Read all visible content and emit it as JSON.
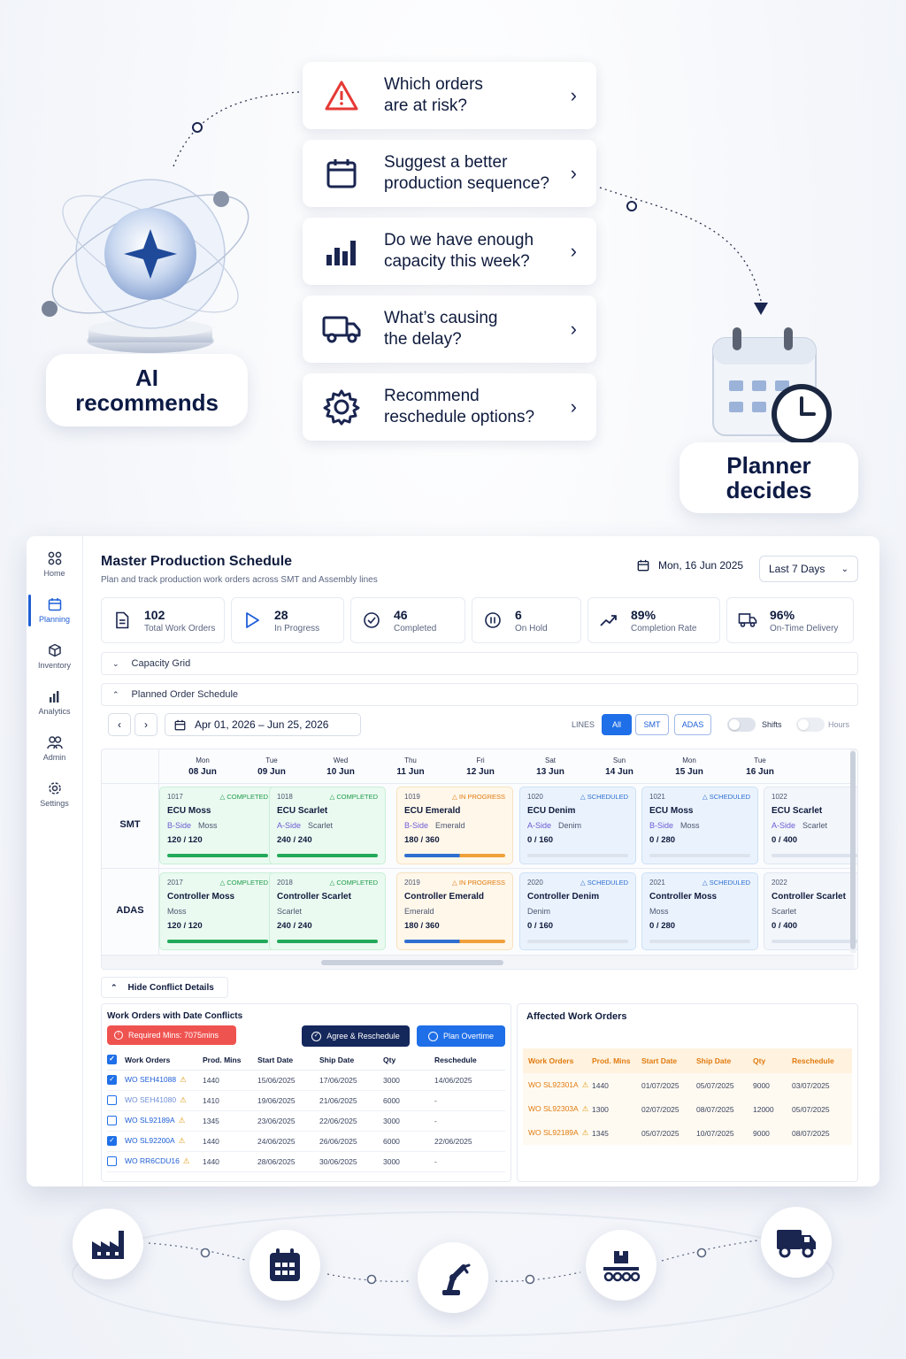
{
  "hero": {
    "ai_label": "AI\nrecommends",
    "planner_label": "Planner\ndecides",
    "questions": [
      {
        "icon": "warning-icon",
        "text": "Which orders\nare at risk?"
      },
      {
        "icon": "calendar-icon",
        "text": "Suggest a better\nproduction sequence?"
      },
      {
        "icon": "bar-chart-icon",
        "text": "Do we have enough\ncapacity this week?"
      },
      {
        "icon": "truck-icon",
        "text": "What’s causing\nthe delay?"
      },
      {
        "icon": "gear-icon",
        "text": "Recommend\nreschedule options?"
      }
    ]
  },
  "sidebar": {
    "items": [
      {
        "label": "Home",
        "icon": "grid-icon"
      },
      {
        "label": "Planning",
        "icon": "calendar-icon",
        "active": true
      },
      {
        "label": "Inventory",
        "icon": "box-icon"
      },
      {
        "label": "Analytics",
        "icon": "bar-chart-icon"
      },
      {
        "label": "Admin",
        "icon": "users-icon"
      },
      {
        "label": "Settings",
        "icon": "gear-icon"
      }
    ]
  },
  "header": {
    "title": "Master Production Schedule",
    "subtitle": "Plan and track production work orders across SMT and Assembly lines",
    "date": "Mon, 16 Jun 2025",
    "range": "Last 7 Days"
  },
  "kpis": [
    {
      "value": "102",
      "label": "Total Work Orders",
      "icon": "document-icon"
    },
    {
      "value": "28",
      "label": "In Progress",
      "icon": "play-icon"
    },
    {
      "value": "46",
      "label": "Completed",
      "icon": "check-circle-icon"
    },
    {
      "value": "6",
      "label": "On Hold",
      "icon": "pause-icon"
    },
    {
      "value": "89%",
      "label": "Completion Rate",
      "icon": "trend-up-icon"
    },
    {
      "value": "96%",
      "label": "On-Time Delivery",
      "icon": "truck-icon"
    }
  ],
  "sections": {
    "capacity_grid": "Capacity Grid",
    "planned_schedule": "Planned Order Schedule",
    "hide_conflicts": "Hide Conflict Details"
  },
  "toolbar": {
    "date_range": "Apr 01, 2026 – Jun 25, 2026",
    "lines_label": "LINES",
    "chips": [
      "All",
      "SMT",
      "ADAS"
    ],
    "shifts_label": "Shifts",
    "hours_label": "Hours"
  },
  "days": [
    {
      "dow": "Mon",
      "date": "08 Jun"
    },
    {
      "dow": "Tue",
      "date": "09 Jun"
    },
    {
      "dow": "Wed",
      "date": "10 Jun"
    },
    {
      "dow": "Thu",
      "date": "11 Jun"
    },
    {
      "dow": "Fri",
      "date": "12 Jun"
    },
    {
      "dow": "Sat",
      "date": "13 Jun"
    },
    {
      "dow": "Sun",
      "date": "14 Jun"
    },
    {
      "dow": "Mon",
      "date": "15 Jun"
    },
    {
      "dow": "Tue",
      "date": "16 Jun"
    }
  ],
  "rows": [
    {
      "line": "SMT",
      "orders": [
        {
          "id": "1017",
          "status": "COMPLETED",
          "kind": "completed",
          "name": "ECU Moss",
          "side": "B-Side",
          "variant": "Moss",
          "qty": "120 / 120",
          "progress": 1.0
        },
        {
          "id": "1018",
          "status": "COMPLETED",
          "kind": "completed",
          "name": "ECU Scarlet",
          "side": "A-Side",
          "variant": "Scarlet",
          "qty": "240 / 240",
          "progress": 1.0
        },
        {
          "id": "1019",
          "status": "IN PROGRESS",
          "kind": "inprogress",
          "name": "ECU Emerald",
          "side": "B-Side",
          "variant": "Emerald",
          "qty": "180 / 360",
          "progress": 1.0
        },
        {
          "id": "1020",
          "status": "SCHEDULED",
          "kind": "scheduled",
          "name": "ECU Denim",
          "side": "A-Side",
          "variant": "Denim",
          "qty": "0 / 160",
          "progress": 0.0
        },
        {
          "id": "1021",
          "status": "SCHEDULED",
          "kind": "scheduled",
          "name": "ECU Moss",
          "side": "B-Side",
          "variant": "Moss",
          "qty": "0 / 280",
          "progress": 0.0
        },
        {
          "id": "1022",
          "status": "",
          "kind": "pending",
          "name": "ECU Scarlet",
          "side": "A-Side",
          "variant": "Scarlet",
          "qty": "0 / 400",
          "progress": 0.0
        }
      ]
    },
    {
      "line": "ADAS",
      "orders": [
        {
          "id": "2017",
          "status": "COMPLETED",
          "kind": "completed",
          "name": "Controller Moss",
          "side": "",
          "variant": "Moss",
          "qty": "120 / 120",
          "progress": 1.0
        },
        {
          "id": "2018",
          "status": "COMPLETED",
          "kind": "completed",
          "name": "Controller Scarlet",
          "side": "",
          "variant": "Scarlet",
          "qty": "240 / 240",
          "progress": 1.0
        },
        {
          "id": "2019",
          "status": "IN PROGRESS",
          "kind": "inprogress",
          "name": "Controller Emerald",
          "side": "",
          "variant": "Emerald",
          "qty": "180 / 360",
          "progress": 1.0
        },
        {
          "id": "2020",
          "status": "SCHEDULED",
          "kind": "scheduled",
          "name": "Controller Denim",
          "side": "",
          "variant": "Denim",
          "qty": "0 / 160",
          "progress": 0.0
        },
        {
          "id": "2021",
          "status": "SCHEDULED",
          "kind": "scheduled",
          "name": "Controller Moss",
          "side": "",
          "variant": "Moss",
          "qty": "0 / 280",
          "progress": 0.0
        },
        {
          "id": "2022",
          "status": "",
          "kind": "pending",
          "name": "Controller Scarlet",
          "side": "",
          "variant": "Scarlet",
          "qty": "0 / 400",
          "progress": 0.0
        }
      ]
    }
  ],
  "conflicts": {
    "title": "Work Orders with Date Conflicts",
    "required": "Required Mins: 7075mins",
    "agree_btn": "Agree & Reschedule",
    "overtime_btn": "Plan Overtime",
    "columns": [
      "Work Orders",
      "Prod. Mins",
      "Start Date",
      "Ship Date",
      "Qty",
      "Reschedule"
    ],
    "rows": [
      {
        "checked": true,
        "wo": "WO SEH41088",
        "mins": "1440",
        "start": "15/06/2025",
        "ship": "17/06/2025",
        "qty": "3000",
        "resched": "14/06/2025"
      },
      {
        "checked": false,
        "wo": "WO SEH41080",
        "mins": "1410",
        "start": "19/06/2025",
        "ship": "21/06/2025",
        "qty": "6000",
        "resched": "-"
      },
      {
        "checked": false,
        "wo": "WO SL92189A",
        "mins": "1345",
        "start": "23/06/2025",
        "ship": "22/06/2025",
        "qty": "3000",
        "resched": "-"
      },
      {
        "checked": true,
        "wo": "WO SL92200A",
        "mins": "1440",
        "start": "24/06/2025",
        "ship": "26/06/2025",
        "qty": "6000",
        "resched": "22/06/2025"
      },
      {
        "checked": false,
        "wo": "WO RR6CDU16",
        "mins": "1440",
        "start": "28/06/2025",
        "ship": "30/06/2025",
        "qty": "3000",
        "resched": "-"
      }
    ]
  },
  "affected": {
    "title": "Affected Work Orders",
    "columns": [
      "Work Orders",
      "Prod. Mins",
      "Start Date",
      "Ship Date",
      "Qty",
      "Reschedule"
    ],
    "rows": [
      {
        "wo": "WO SL92301A",
        "mins": "1440",
        "start": "01/07/2025",
        "ship": "05/07/2025",
        "qty": "9000",
        "resched": "03/07/2025"
      },
      {
        "wo": "WO SL92303A",
        "mins": "1300",
        "start": "02/07/2025",
        "ship": "08/07/2025",
        "qty": "12000",
        "resched": "05/07/2025"
      },
      {
        "wo": "WO SL92189A",
        "mins": "1345",
        "start": "05/07/2025",
        "ship": "10/07/2025",
        "qty": "9000",
        "resched": "08/07/2025"
      }
    ]
  },
  "footer_icons": [
    "factory-icon",
    "calendar-icon",
    "robot-arm-icon",
    "conveyor-icon",
    "truck-icon"
  ],
  "colors": {
    "accent": "#1f6fe8",
    "completed": "#22a95a",
    "in_progress": "#e07b10",
    "scheduled": "#2f6fd0",
    "danger": "#ef5350",
    "navy": "#0f1b3d"
  }
}
